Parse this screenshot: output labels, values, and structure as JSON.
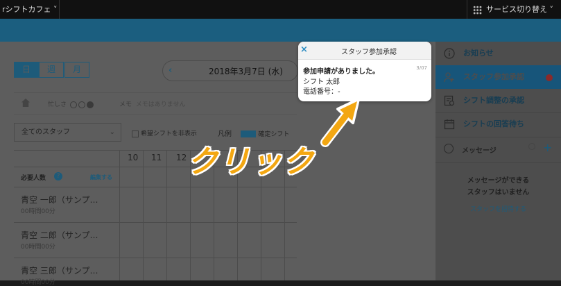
{
  "topbar": {
    "brand": "rシフトカフェ ˅",
    "service_switch": "サービス切り替え ˅"
  },
  "views": {
    "day": "日",
    "week": "週",
    "month": "月",
    "active": "day"
  },
  "date_nav": {
    "prev_arrow": "‹",
    "date": "2018年3月7日 (水)"
  },
  "filters": {
    "busy_label": "忙しさ",
    "memo_label": "メモ",
    "memo_value": "メモはありません",
    "staff_select": "全てのスタッフ",
    "hide_requested": "希望シフトを非表示",
    "legend_label": "凡例",
    "legend_item": "確定シフト"
  },
  "table": {
    "hours": [
      "10",
      "11",
      "12"
    ],
    "required_label": "必要人数",
    "edit_label": "編集する",
    "rows": [
      {
        "name": "青空 一郎（サンプ…",
        "hours": "00時間00分"
      },
      {
        "name": "青空 二郎（サンプ…",
        "hours": "00時間00分"
      },
      {
        "name": "青空 三郎（サンプ…",
        "hours": "00時間00分"
      }
    ]
  },
  "sidebar": {
    "items": [
      {
        "label": "お知らせ",
        "icon": "info-icon"
      },
      {
        "label": "スタッフ参加承認",
        "icon": "add-user-icon"
      },
      {
        "label": "シフト調整の承認",
        "icon": "approve-icon"
      },
      {
        "label": "シフトの回答待ち",
        "icon": "calendar-icon"
      }
    ],
    "message_header": "メッセージ",
    "plus": "+",
    "empty_line1": "メッセージができる",
    "empty_line2": "スタッフはいません",
    "invite_link": "スタッフを招待する"
  },
  "popup": {
    "close": "×",
    "title": "スタッフ参加承認",
    "message": "参加申請がありました。",
    "date": "3/07",
    "name": "シフト 太郎",
    "phone": "電話番号：-"
  },
  "annotation": {
    "text": "クリック",
    "color": "#f3a712"
  },
  "colors": {
    "accent": "#1d5b7a",
    "badge": "#c0392b"
  }
}
